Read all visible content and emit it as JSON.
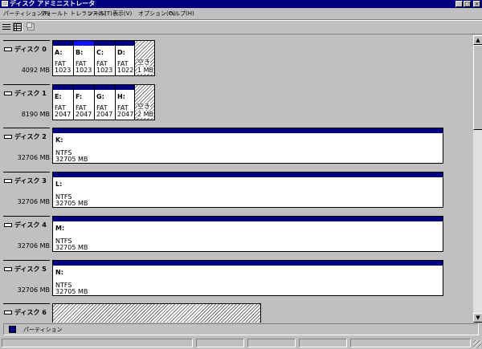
{
  "window": {
    "title": "ディスク アドミニストレータ"
  },
  "titlebar_buttons": {
    "minimize": "_",
    "maximize": "□",
    "close": "×"
  },
  "menu": [
    {
      "label": "パーティション(P)"
    },
    {
      "label": "フォールト トレランス(S)"
    },
    {
      "label": "ツール(T)"
    },
    {
      "label": "表示(V)"
    },
    {
      "label": "オプション(O)"
    },
    {
      "label": "ヘルプ(H)"
    }
  ],
  "toolbar": [
    {
      "icon": "volumes-view-icon"
    },
    {
      "icon": "disk-config-view-icon"
    },
    {
      "icon": "properties-icon"
    }
  ],
  "disks": [
    {
      "name": "ディスク 0",
      "size": "4092 MB",
      "partitions": [
        {
          "letter": "A:",
          "fs": "FAT",
          "size": "1023"
        },
        {
          "letter": "B:",
          "fs": "FAT",
          "size": "1023"
        },
        {
          "letter": "C:",
          "fs": "FAT",
          "size": "1023"
        },
        {
          "letter": "D:",
          "fs": "FAT",
          "size": "1022"
        }
      ],
      "free": {
        "label": "空き",
        "size": "1 MB"
      }
    },
    {
      "name": "ディスク 1",
      "size": "8190 MB",
      "partitions": [
        {
          "letter": "E:",
          "fs": "FAT",
          "size": "2047"
        },
        {
          "letter": "F:",
          "fs": "FAT",
          "size": "2047"
        },
        {
          "letter": "G:",
          "fs": "FAT",
          "size": "2047"
        },
        {
          "letter": "H:",
          "fs": "FAT",
          "size": "2047"
        }
      ],
      "free": {
        "label": "空き",
        "size": "2 MB"
      }
    },
    {
      "name": "ディスク 2",
      "size": "32706 MB",
      "partition": {
        "letter": "K:",
        "fs": "NTFS",
        "size": "32705 MB"
      }
    },
    {
      "name": "ディスク 3",
      "size": "32706 MB",
      "partition": {
        "letter": "L:",
        "fs": "NTFS",
        "size": "32705 MB"
      }
    },
    {
      "name": "ディスク 4",
      "size": "32706 MB",
      "partition": {
        "letter": "M:",
        "fs": "NTFS",
        "size": "32705 MB"
      }
    },
    {
      "name": "ディスク 5",
      "size": "32706 MB",
      "partition": {
        "letter": "N:",
        "fs": "NTFS",
        "size": "32705 MB"
      }
    },
    {
      "name": "ディスク 6"
    }
  ],
  "scrollbar": {
    "up": "▲",
    "down": "▼"
  },
  "legend": {
    "label": "パーティション",
    "color": "#000080"
  }
}
